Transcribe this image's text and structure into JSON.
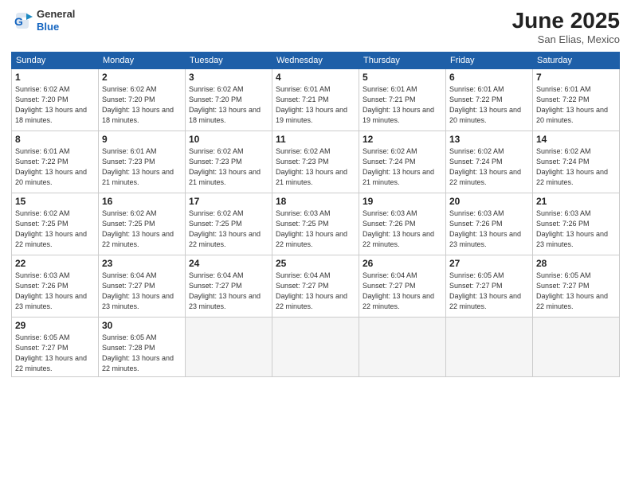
{
  "header": {
    "logo": {
      "general": "General",
      "blue": "Blue"
    },
    "title": "June 2025",
    "location": "San Elias, Mexico"
  },
  "calendar": {
    "days_of_week": [
      "Sunday",
      "Monday",
      "Tuesday",
      "Wednesday",
      "Thursday",
      "Friday",
      "Saturday"
    ],
    "weeks": [
      [
        {
          "day": "1",
          "sunrise": "6:02 AM",
          "sunset": "7:20 PM",
          "daylight": "13 hours and 18 minutes."
        },
        {
          "day": "2",
          "sunrise": "6:02 AM",
          "sunset": "7:20 PM",
          "daylight": "13 hours and 18 minutes."
        },
        {
          "day": "3",
          "sunrise": "6:02 AM",
          "sunset": "7:20 PM",
          "daylight": "13 hours and 18 minutes."
        },
        {
          "day": "4",
          "sunrise": "6:01 AM",
          "sunset": "7:21 PM",
          "daylight": "13 hours and 19 minutes."
        },
        {
          "day": "5",
          "sunrise": "6:01 AM",
          "sunset": "7:21 PM",
          "daylight": "13 hours and 19 minutes."
        },
        {
          "day": "6",
          "sunrise": "6:01 AM",
          "sunset": "7:22 PM",
          "daylight": "13 hours and 20 minutes."
        },
        {
          "day": "7",
          "sunrise": "6:01 AM",
          "sunset": "7:22 PM",
          "daylight": "13 hours and 20 minutes."
        }
      ],
      [
        {
          "day": "8",
          "sunrise": "6:01 AM",
          "sunset": "7:22 PM",
          "daylight": "13 hours and 20 minutes."
        },
        {
          "day": "9",
          "sunrise": "6:01 AM",
          "sunset": "7:23 PM",
          "daylight": "13 hours and 21 minutes."
        },
        {
          "day": "10",
          "sunrise": "6:02 AM",
          "sunset": "7:23 PM",
          "daylight": "13 hours and 21 minutes."
        },
        {
          "day": "11",
          "sunrise": "6:02 AM",
          "sunset": "7:23 PM",
          "daylight": "13 hours and 21 minutes."
        },
        {
          "day": "12",
          "sunrise": "6:02 AM",
          "sunset": "7:24 PM",
          "daylight": "13 hours and 21 minutes."
        },
        {
          "day": "13",
          "sunrise": "6:02 AM",
          "sunset": "7:24 PM",
          "daylight": "13 hours and 22 minutes."
        },
        {
          "day": "14",
          "sunrise": "6:02 AM",
          "sunset": "7:24 PM",
          "daylight": "13 hours and 22 minutes."
        }
      ],
      [
        {
          "day": "15",
          "sunrise": "6:02 AM",
          "sunset": "7:25 PM",
          "daylight": "13 hours and 22 minutes."
        },
        {
          "day": "16",
          "sunrise": "6:02 AM",
          "sunset": "7:25 PM",
          "daylight": "13 hours and 22 minutes."
        },
        {
          "day": "17",
          "sunrise": "6:02 AM",
          "sunset": "7:25 PM",
          "daylight": "13 hours and 22 minutes."
        },
        {
          "day": "18",
          "sunrise": "6:03 AM",
          "sunset": "7:25 PM",
          "daylight": "13 hours and 22 minutes."
        },
        {
          "day": "19",
          "sunrise": "6:03 AM",
          "sunset": "7:26 PM",
          "daylight": "13 hours and 22 minutes."
        },
        {
          "day": "20",
          "sunrise": "6:03 AM",
          "sunset": "7:26 PM",
          "daylight": "13 hours and 23 minutes."
        },
        {
          "day": "21",
          "sunrise": "6:03 AM",
          "sunset": "7:26 PM",
          "daylight": "13 hours and 23 minutes."
        }
      ],
      [
        {
          "day": "22",
          "sunrise": "6:03 AM",
          "sunset": "7:26 PM",
          "daylight": "13 hours and 23 minutes."
        },
        {
          "day": "23",
          "sunrise": "6:04 AM",
          "sunset": "7:27 PM",
          "daylight": "13 hours and 23 minutes."
        },
        {
          "day": "24",
          "sunrise": "6:04 AM",
          "sunset": "7:27 PM",
          "daylight": "13 hours and 23 minutes."
        },
        {
          "day": "25",
          "sunrise": "6:04 AM",
          "sunset": "7:27 PM",
          "daylight": "13 hours and 22 minutes."
        },
        {
          "day": "26",
          "sunrise": "6:04 AM",
          "sunset": "7:27 PM",
          "daylight": "13 hours and 22 minutes."
        },
        {
          "day": "27",
          "sunrise": "6:05 AM",
          "sunset": "7:27 PM",
          "daylight": "13 hours and 22 minutes."
        },
        {
          "day": "28",
          "sunrise": "6:05 AM",
          "sunset": "7:27 PM",
          "daylight": "13 hours and 22 minutes."
        }
      ],
      [
        {
          "day": "29",
          "sunrise": "6:05 AM",
          "sunset": "7:27 PM",
          "daylight": "13 hours and 22 minutes."
        },
        {
          "day": "30",
          "sunrise": "6:05 AM",
          "sunset": "7:28 PM",
          "daylight": "13 hours and 22 minutes."
        },
        null,
        null,
        null,
        null,
        null
      ]
    ]
  }
}
